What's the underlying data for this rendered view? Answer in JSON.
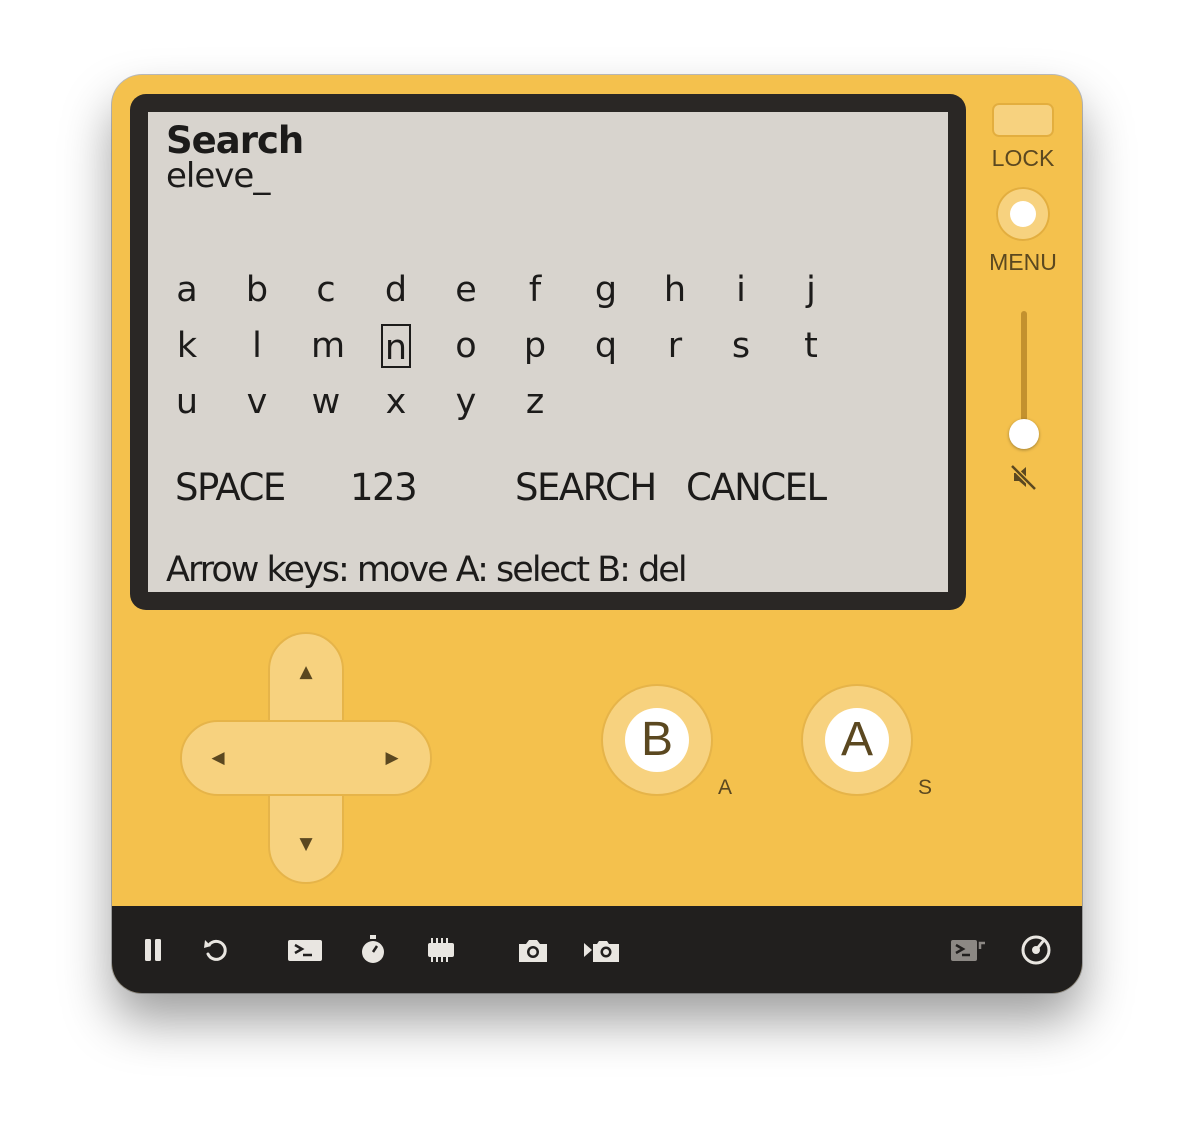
{
  "screen": {
    "title": "Search",
    "query": "eleve_",
    "keyboard_rows": [
      [
        "a",
        "b",
        "c",
        "d",
        "e",
        "f",
        "g",
        "h",
        "i",
        "j"
      ],
      [
        "k",
        "l",
        "m",
        "n",
        "o",
        "p",
        "q",
        "r",
        "s",
        "t"
      ],
      [
        "u",
        "v",
        "w",
        "x",
        "y",
        "z"
      ]
    ],
    "selected_key": "n",
    "actions": {
      "space": "SPACE",
      "numbers": "123",
      "search": "SEARCH",
      "cancel": "CANCEL"
    },
    "help": "Arrow keys: move   A: select   B: del"
  },
  "side": {
    "lock_label": "LOCK",
    "menu_label": "MENU",
    "volume_muted": true
  },
  "controls": {
    "dpad_arrows": {
      "up": "▲",
      "down": "▼",
      "left": "◀",
      "right": "▶"
    },
    "b_button": {
      "label": "B",
      "key_hint": "A"
    },
    "a_button": {
      "label": "A",
      "key_hint": "S"
    }
  },
  "toolbar": {
    "icons": [
      "pause-icon",
      "restart-icon",
      "console-icon",
      "stopwatch-icon",
      "memory-chip-icon",
      "screenshot-camera-icon",
      "record-video-icon",
      "device-console-icon",
      "device-gauge-icon"
    ]
  },
  "colors": {
    "device_body": "#f4c14d",
    "button_face": "#f7d27f",
    "screen_background": "#d8d4ce",
    "screen_text": "#1c1b1a",
    "bezel": "#2a2725",
    "toolbar": "#211f1e"
  }
}
